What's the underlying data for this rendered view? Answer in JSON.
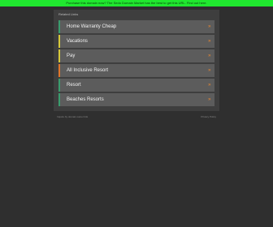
{
  "banner": {
    "text": "Purchase this domain now? The Sedo Domain Market has the best to get this URL. Find out here.",
    "color": "#20e82f"
  },
  "panel": {
    "heading": "Related Links"
  },
  "links": [
    {
      "label": "Home Warranty Cheap",
      "arrow": "»",
      "accent": "#3a9d6e"
    },
    {
      "label": "Vacations",
      "arrow": "»",
      "accent": "#d8c93a"
    },
    {
      "label": "Pay",
      "arrow": "»",
      "accent": "#d8c93a"
    },
    {
      "label": "All Inclusive Resort",
      "arrow": "»",
      "accent": "#e0762a"
    },
    {
      "label": "Resort",
      "arrow": "»",
      "accent": "#3a9d6e"
    },
    {
      "label": "Beaches Resorts",
      "arrow": "»",
      "accent": "#3a9d6e"
    }
  ],
  "footer": {
    "left": "Inquire by domain owner link",
    "right": "Privacy Policy"
  },
  "colors": {
    "background": "#2f2f2f",
    "panel": "#3e3e3e",
    "item": "#5c5c5c",
    "arrow": "#f28a2e"
  }
}
